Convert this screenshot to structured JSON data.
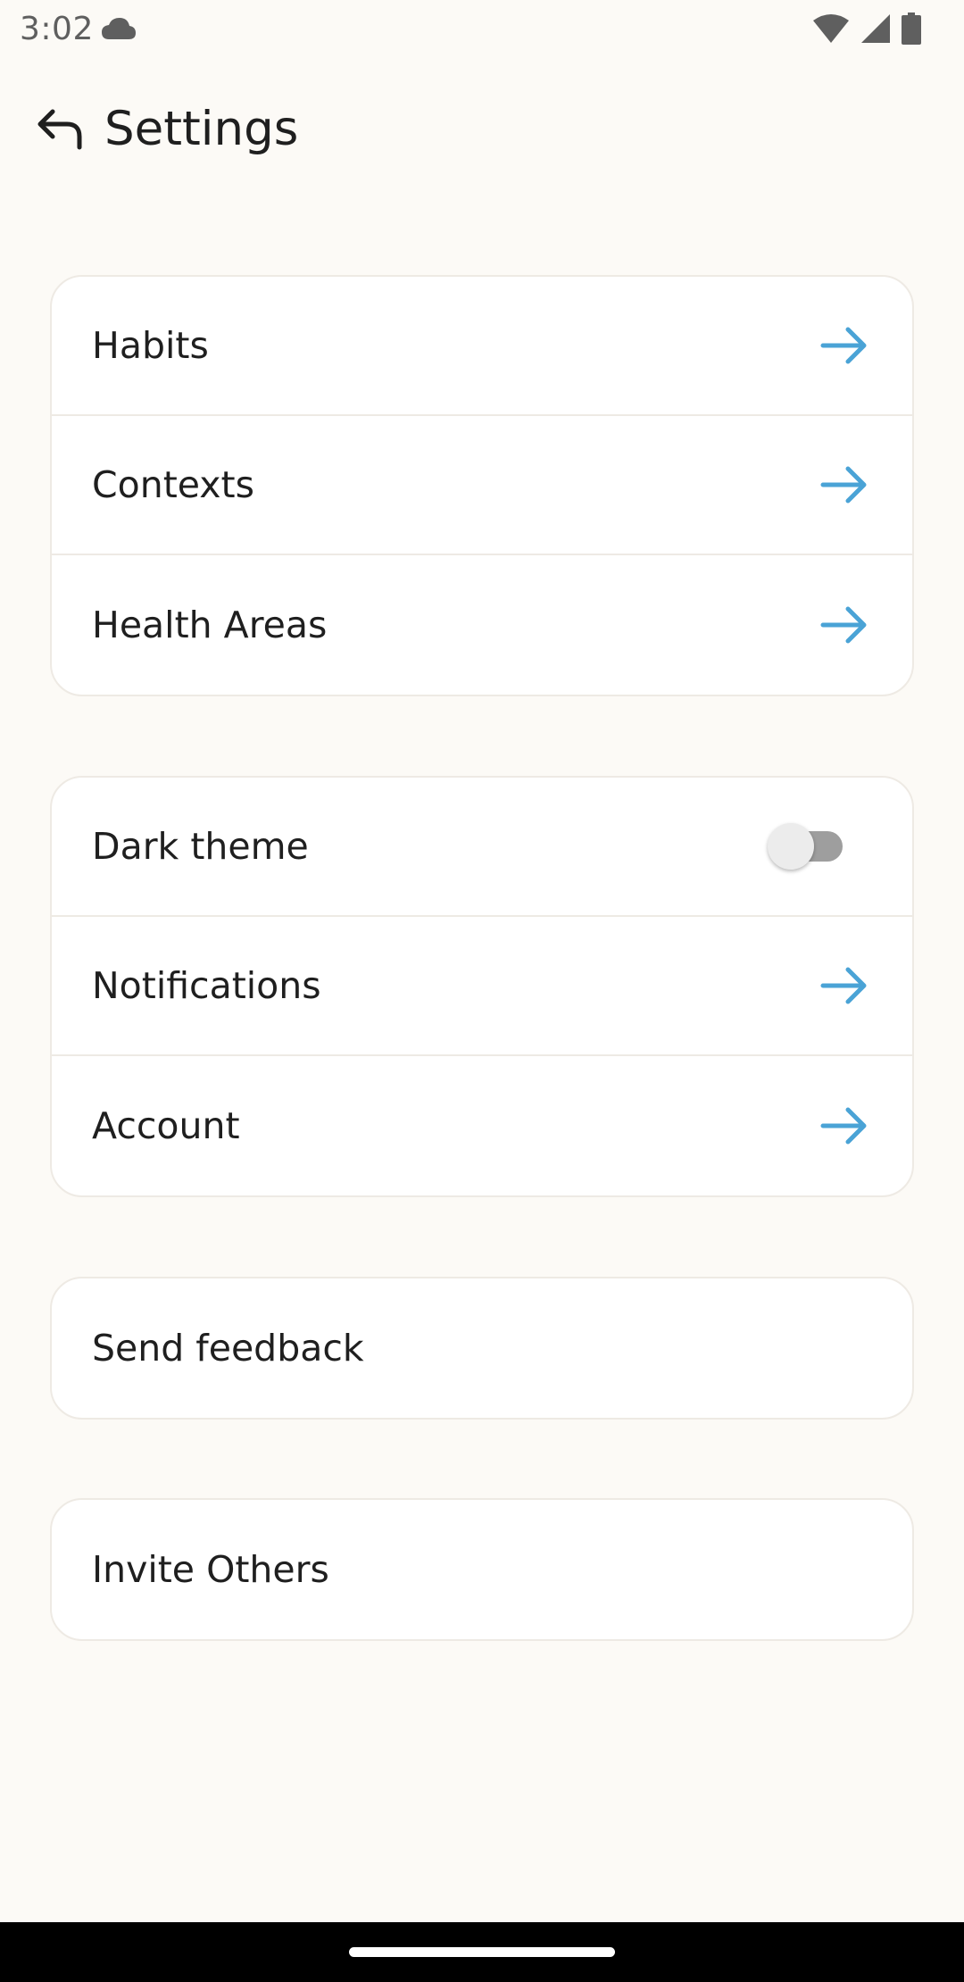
{
  "status_bar": {
    "time": "3:02",
    "icons": [
      "cloud-icon",
      "wifi-icon",
      "cellular-signal-icon",
      "battery-icon"
    ]
  },
  "header": {
    "title": "Settings",
    "back_icon": "back-arrow-icon"
  },
  "groups": {
    "library": {
      "items": [
        {
          "label": "Habits",
          "icon": "arrow-right-icon"
        },
        {
          "label": "Contexts",
          "icon": "arrow-right-icon"
        },
        {
          "label": "Health Areas",
          "icon": "arrow-right-icon"
        }
      ]
    },
    "preferences": {
      "dark_theme": {
        "label": "Dark theme",
        "enabled": false
      },
      "items": [
        {
          "label": "Notifications",
          "icon": "arrow-right-icon"
        },
        {
          "label": "Account",
          "icon": "arrow-right-icon"
        }
      ]
    },
    "feedback": {
      "label": "Send feedback"
    },
    "invite": {
      "label": "Invite Others"
    }
  },
  "colors": {
    "background": "#FCFAF6",
    "card": "#FFFFFF",
    "accent_arrow": "#4AA3D6",
    "text": "#1F1F1F"
  }
}
